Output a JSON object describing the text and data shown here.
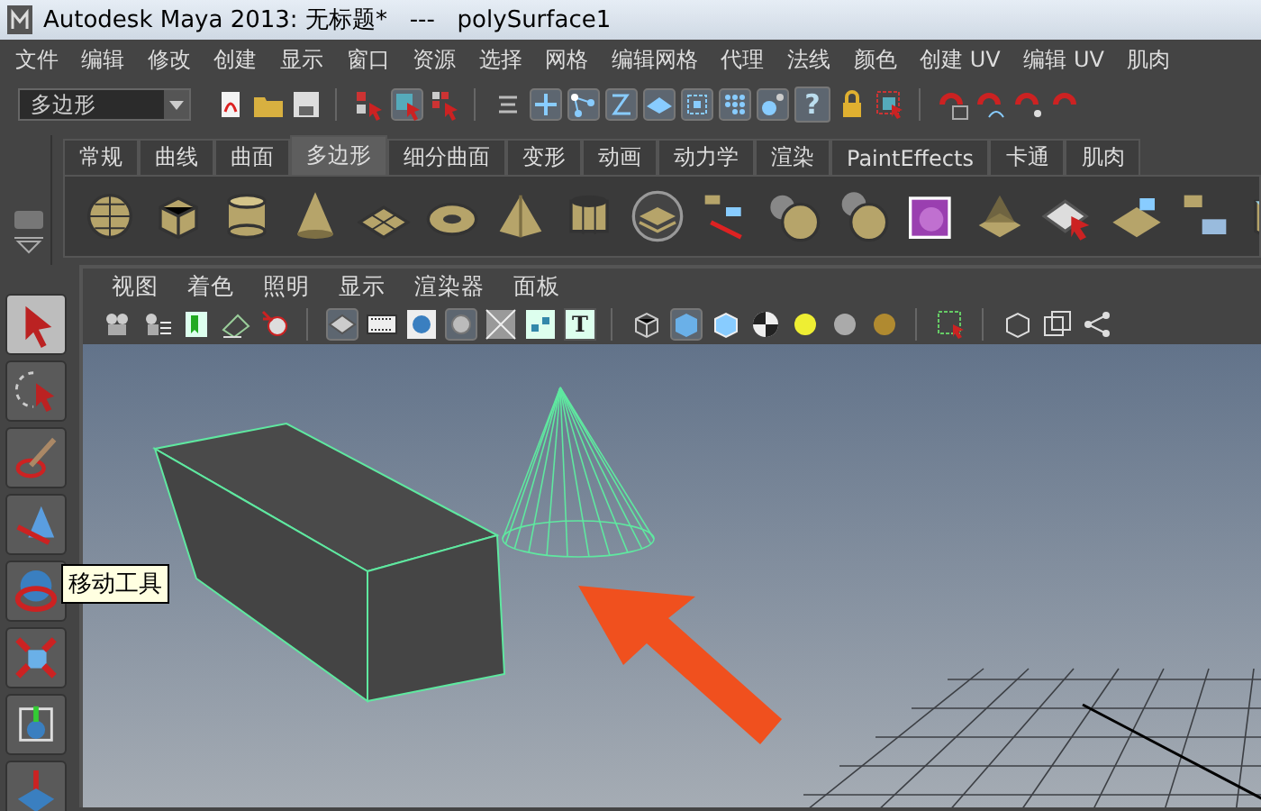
{
  "window": {
    "title": "Autodesk Maya 2013: 无标题*   ---   polySurface1"
  },
  "menu_bar": [
    "文件",
    "编辑",
    "修改",
    "创建",
    "显示",
    "窗口",
    "资源",
    "选择",
    "网格",
    "编辑网格",
    "代理",
    "法线",
    "颜色",
    "创建 UV",
    "编辑 UV",
    "肌肉"
  ],
  "toolbar": {
    "mode_dropdown": {
      "value": "多边形"
    },
    "help_button": "?"
  },
  "shelf": {
    "tabs": [
      {
        "label": "常规",
        "selected": false
      },
      {
        "label": "曲线",
        "selected": false
      },
      {
        "label": "曲面",
        "selected": false
      },
      {
        "label": "多边形",
        "selected": true
      },
      {
        "label": "细分曲面",
        "selected": false
      },
      {
        "label": "变形",
        "selected": false
      },
      {
        "label": "动画",
        "selected": false
      },
      {
        "label": "动力学",
        "selected": false
      },
      {
        "label": "渲染",
        "selected": false
      },
      {
        "label": "PaintEffects",
        "selected": false
      },
      {
        "label": "卡通",
        "selected": false
      },
      {
        "label": "肌肉",
        "selected": false
      }
    ]
  },
  "toolbox": [
    {
      "selected": true
    },
    {
      "selected": false
    },
    {
      "selected": false
    },
    {
      "selected": false
    },
    {
      "selected": false
    },
    {
      "selected": false
    },
    {
      "selected": false
    },
    {
      "selected": false
    }
  ],
  "tooltip": "移动工具",
  "viewport": {
    "menus": [
      "视图",
      "着色",
      "照明",
      "显示",
      "渲染器",
      "面板"
    ],
    "text_icon": "T"
  }
}
